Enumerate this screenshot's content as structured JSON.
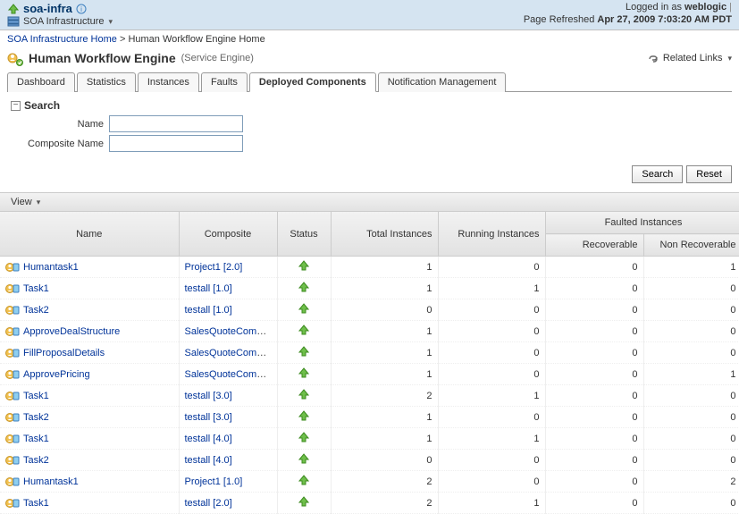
{
  "topbar": {
    "title": "soa-infra",
    "subtitle": "SOA Infrastructure",
    "logged_in_as_label": "Logged in as",
    "user": "weblogic",
    "refresh_label": "Page Refreshed",
    "refresh_time": "Apr 27, 2009 7:03:20 AM PDT"
  },
  "breadcrumb": {
    "home": "SOA Infrastructure Home",
    "current": "Human Workflow Engine Home"
  },
  "page": {
    "title": "Human Workflow Engine",
    "subtitle": "(Service Engine)",
    "related_links": "Related Links"
  },
  "tabs": [
    {
      "label": "Dashboard",
      "active": false
    },
    {
      "label": "Statistics",
      "active": false
    },
    {
      "label": "Instances",
      "active": false
    },
    {
      "label": "Faults",
      "active": false
    },
    {
      "label": "Deployed Components",
      "active": true
    },
    {
      "label": "Notification Management",
      "active": false
    }
  ],
  "search": {
    "title": "Search",
    "name_label": "Name",
    "composite_label": "Composite Name",
    "name_value": "",
    "composite_value": "",
    "search_btn": "Search",
    "reset_btn": "Reset"
  },
  "view_menu": "View",
  "columns": {
    "name": "Name",
    "composite": "Composite",
    "status": "Status",
    "total": "Total Instances",
    "running": "Running Instances",
    "faulted": "Faulted Instances",
    "recoverable": "Recoverable",
    "nonrecoverable": "Non Recoverable"
  },
  "rows": [
    {
      "name": "Humantask1",
      "composite": "Project1 [2.0]",
      "status": "up",
      "total": 1,
      "running": 0,
      "recov": 0,
      "nonrecov": 1
    },
    {
      "name": "Task1",
      "composite": "testall [1.0]",
      "status": "up",
      "total": 1,
      "running": 1,
      "recov": 0,
      "nonrecov": 0
    },
    {
      "name": "Task2",
      "composite": "testall [1.0]",
      "status": "up",
      "total": 0,
      "running": 0,
      "recov": 0,
      "nonrecov": 0
    },
    {
      "name": "ApproveDealStructure",
      "composite": "SalesQuoteComposit",
      "status": "up",
      "total": 1,
      "running": 0,
      "recov": 0,
      "nonrecov": 0
    },
    {
      "name": "FillProposalDetails",
      "composite": "SalesQuoteComposit",
      "status": "up",
      "total": 1,
      "running": 0,
      "recov": 0,
      "nonrecov": 0
    },
    {
      "name": "ApprovePricing",
      "composite": "SalesQuoteComposit",
      "status": "up",
      "total": 1,
      "running": 0,
      "recov": 0,
      "nonrecov": 1
    },
    {
      "name": "Task1",
      "composite": "testall [3.0]",
      "status": "up",
      "total": 2,
      "running": 1,
      "recov": 0,
      "nonrecov": 0
    },
    {
      "name": "Task2",
      "composite": "testall [3.0]",
      "status": "up",
      "total": 1,
      "running": 0,
      "recov": 0,
      "nonrecov": 0
    },
    {
      "name": "Task1",
      "composite": "testall [4.0]",
      "status": "up",
      "total": 1,
      "running": 1,
      "recov": 0,
      "nonrecov": 0
    },
    {
      "name": "Task2",
      "composite": "testall [4.0]",
      "status": "up",
      "total": 0,
      "running": 0,
      "recov": 0,
      "nonrecov": 0
    },
    {
      "name": "Humantask1",
      "composite": "Project1 [1.0]",
      "status": "up",
      "total": 2,
      "running": 0,
      "recov": 0,
      "nonrecov": 2
    },
    {
      "name": "Task1",
      "composite": "testall [2.0]",
      "status": "up",
      "total": 2,
      "running": 1,
      "recov": 0,
      "nonrecov": 0
    }
  ]
}
